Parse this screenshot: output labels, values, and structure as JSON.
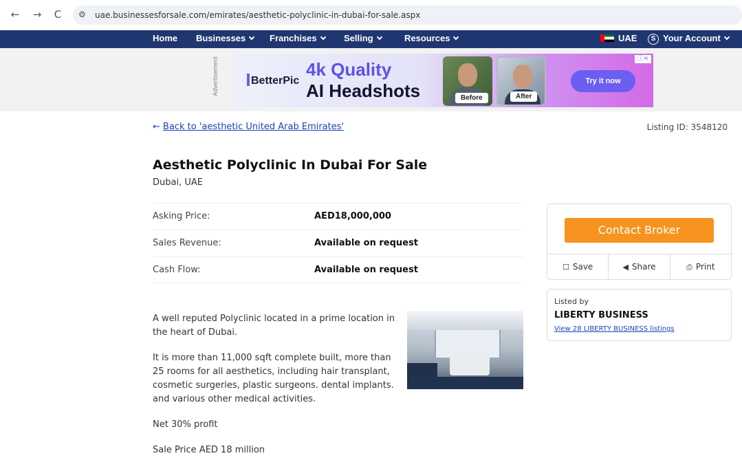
{
  "browser": {
    "url": "uae.businessesforsale.com/emirates/aesthetic-polyclinic-in-dubai-for-sale.aspx",
    "back_glyph": "←",
    "forward_glyph": "→",
    "reload_glyph": "C"
  },
  "nav": {
    "items": [
      {
        "label": "Home",
        "dropdown": false
      },
      {
        "label": "Businesses",
        "dropdown": true
      },
      {
        "label": "Franchises",
        "dropdown": true
      },
      {
        "label": "Selling",
        "dropdown": true
      },
      {
        "label": "Resources",
        "dropdown": true
      }
    ],
    "country": "UAE",
    "account_icon_letter": "S",
    "account": "Your Account"
  },
  "ad": {
    "label": "Advertisement",
    "brand": "BetterPic",
    "headline_1": "4k Quality",
    "headline_2": "AI Headshots",
    "before_tag": "Before",
    "after_tag": "After",
    "cta": "Try it now",
    "close_glyph": "ⓘ✕"
  },
  "listing": {
    "back_link": "Back to 'aesthetic United Arab Emirates'",
    "listing_id": "Listing ID: 3548120",
    "title": "Aesthetic Polyclinic In Dubai For Sale",
    "location": "Dubai, UAE",
    "financials": [
      {
        "label": "Asking Price:",
        "value": "AED18,000,000"
      },
      {
        "label": "Sales Revenue:",
        "value": "Available on request"
      },
      {
        "label": "Cash Flow:",
        "value": "Available on request"
      }
    ],
    "description": [
      "A well reputed Polyclinic located in a prime location in the heart of Dubai.",
      "It is more than 11,000 sqft complete built, more than 25 rooms for all aesthetics, including hair transplant, cosmetic surgeries, plastic surgeons. dental implants. and various other medical activities.",
      "Net 30% profit",
      "Sale Price AED 18 million"
    ]
  },
  "sidebar": {
    "contact_label": "Contact Broker",
    "actions": [
      {
        "label": "Save",
        "icon": "bookmark-icon"
      },
      {
        "label": "Share",
        "icon": "share-icon"
      },
      {
        "label": "Print",
        "icon": "printer-icon"
      }
    ],
    "listed_by_label": "Listed by",
    "broker_name": "LIBERTY BUSINESS",
    "broker_link": "View 28 LIBERTY BUSINESS listings"
  },
  "colors": {
    "nav_bg": "#1f3671",
    "contact_button": "#f7931e",
    "link": "#1a44b8"
  }
}
